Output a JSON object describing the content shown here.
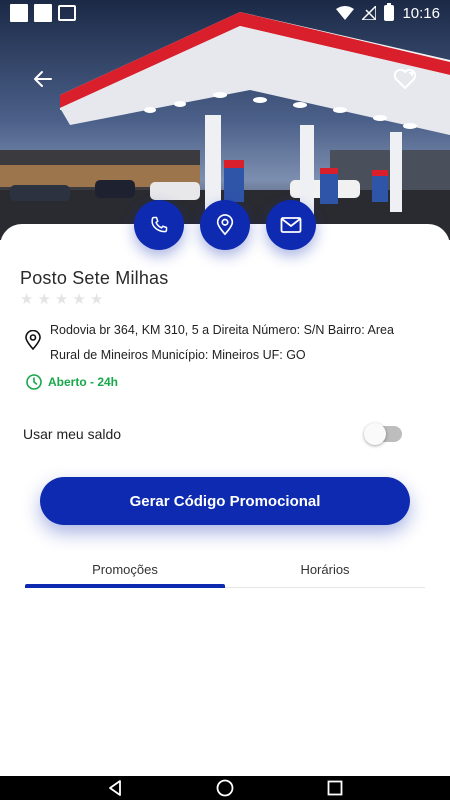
{
  "status_bar": {
    "time": "10:16"
  },
  "icons": {
    "back": "arrow-left-icon",
    "favorite": "heart-plus-icon",
    "phone": "phone-icon",
    "location": "map-pin-icon",
    "email": "envelope-icon",
    "clock": "clock-icon",
    "address_pin": "map-pin-icon"
  },
  "colors": {
    "primary": "#0d2ab0",
    "open_green": "#17a84a",
    "star_empty": "#e4e4e4"
  },
  "station": {
    "name": "Posto Sete Milhas",
    "rating": 0,
    "address": "Rodovia br 364, KM 310, 5 a Direita Número: S/N Bairro: Area Rural de Mineiros Município: Mineiros UF: GO",
    "hours_status": "Aberto - 24h"
  },
  "balance": {
    "label": "Usar meu saldo",
    "enabled": false
  },
  "promo_button": {
    "label": "Gerar Código Promocional"
  },
  "tabs": [
    {
      "label": "Promoções",
      "active": true
    },
    {
      "label": "Horários",
      "active": false
    }
  ]
}
